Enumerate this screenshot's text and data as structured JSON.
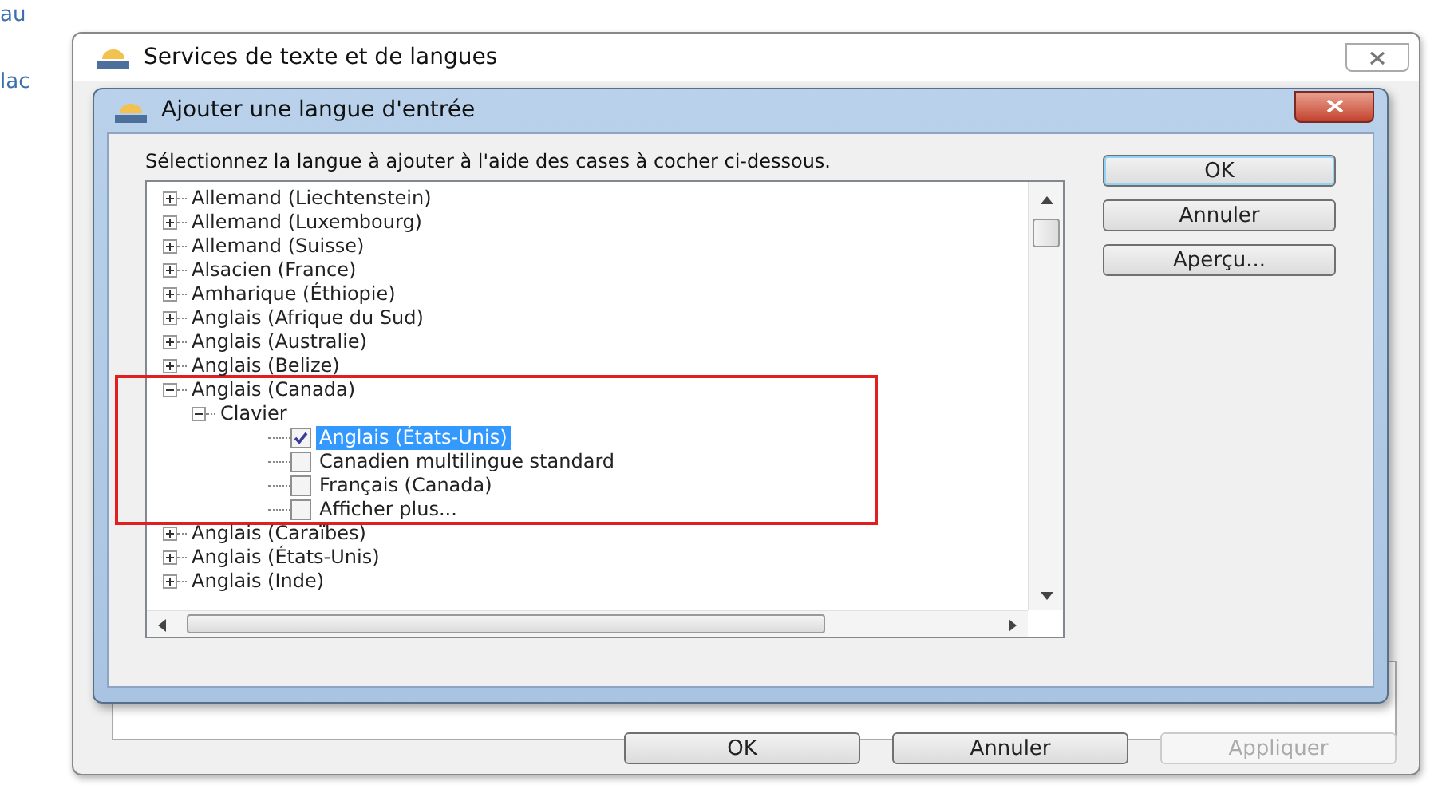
{
  "background_texts": [
    "au",
    "lac"
  ],
  "window": {
    "title": "Services de texte et de langues",
    "buttons": [
      {
        "label": "OK",
        "disabled": false
      },
      {
        "label": "Annuler",
        "disabled": false
      },
      {
        "label": "Appliquer",
        "disabled": true
      }
    ]
  },
  "dialog": {
    "title": "Ajouter une langue d'entrée",
    "instruction": "Sélectionnez la langue à ajouter à l'aide des cases à cocher ci-dessous.",
    "buttons": [
      {
        "label": "OK",
        "default": true
      },
      {
        "label": "Annuler",
        "default": false
      },
      {
        "label": "Aperçu...",
        "default": false
      }
    ],
    "tree": [
      {
        "label": "Allemand (Liechtenstein)",
        "expanded": false,
        "highlighted": false
      },
      {
        "label": "Allemand (Luxembourg)",
        "expanded": false,
        "highlighted": false
      },
      {
        "label": "Allemand (Suisse)",
        "expanded": false,
        "highlighted": false
      },
      {
        "label": "Alsacien (France)",
        "expanded": false,
        "highlighted": false
      },
      {
        "label": "Amharique (Éthiopie)",
        "expanded": false,
        "highlighted": false
      },
      {
        "label": "Anglais (Afrique du Sud)",
        "expanded": false,
        "highlighted": false
      },
      {
        "label": "Anglais (Australie)",
        "expanded": false,
        "highlighted": false
      },
      {
        "label": "Anglais (Belize)",
        "expanded": false,
        "highlighted": false
      },
      {
        "label": "Anglais (Canada)",
        "expanded": true,
        "highlighted": true,
        "children": [
          {
            "label": "Clavier",
            "expanded": true,
            "children": [
              {
                "label": "Anglais (États-Unis)",
                "checked": true,
                "selected": true
              },
              {
                "label": "Canadien multilingue standard",
                "checked": false,
                "selected": false
              },
              {
                "label": "Français (Canada)",
                "checked": false,
                "selected": false
              },
              {
                "label": "Afficher plus...",
                "checked": false,
                "selected": false
              }
            ]
          }
        ]
      },
      {
        "label": "Anglais (Caraïbes)",
        "expanded": false,
        "highlighted": false
      },
      {
        "label": "Anglais (États-Unis)",
        "expanded": false,
        "highlighted": false
      },
      {
        "label": "Anglais (Inde)",
        "expanded": false,
        "highlighted": false
      }
    ]
  }
}
